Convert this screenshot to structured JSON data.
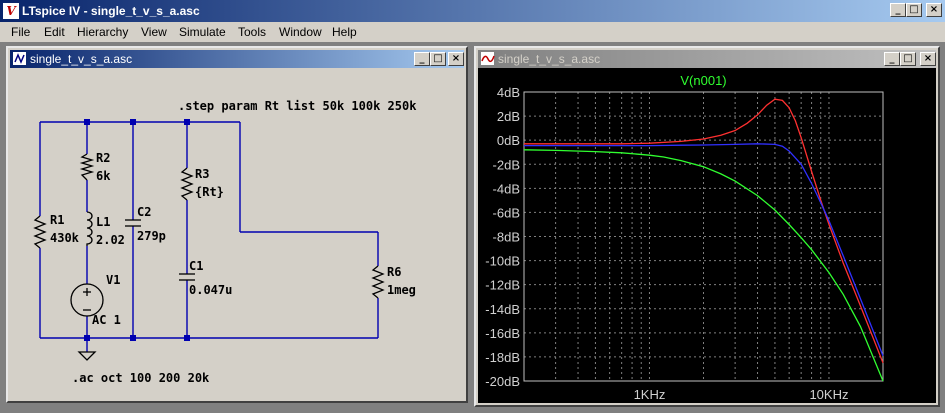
{
  "app": {
    "title": "LTspice IV - single_t_v_s_a.asc",
    "icon": "ltspice-logo-icon",
    "window_buttons": [
      "_",
      "□",
      "×"
    ]
  },
  "menu": [
    "File",
    "Edit",
    "Hierarchy",
    "View",
    "Simulate",
    "Tools",
    "Window",
    "Help"
  ],
  "schematic_window": {
    "title": "single_t_v_s_a.asc",
    "directives": {
      "step": ".step param Rt list 50k 100k 250k",
      "ac": ".ac oct 100 200 20k"
    },
    "components": {
      "R1": {
        "name": "R1",
        "value": "430k"
      },
      "R2": {
        "name": "R2",
        "value": "6k"
      },
      "L1": {
        "name": "L1",
        "value": "2.02"
      },
      "V1": {
        "name": "V1",
        "value": "AC 1"
      },
      "C2": {
        "name": "C2",
        "value": "279p"
      },
      "R3": {
        "name": "R3",
        "value": "{Rt}"
      },
      "C1": {
        "name": "C1",
        "value": "0.047u"
      },
      "R6": {
        "name": "R6",
        "value": "1meg"
      }
    },
    "colors": {
      "wire": "#0000b0",
      "background": "#d4d0c8"
    }
  },
  "plot_window": {
    "title": "single_t_v_s_a.asc",
    "chart_data": {
      "type": "line",
      "title": "V(n001)",
      "x_scale": "log",
      "xlim": [
        200,
        20000
      ],
      "ylim": [
        -20,
        4
      ],
      "yticks": [
        "4dB",
        "2dB",
        "0dB",
        "-2dB",
        "-4dB",
        "-6dB",
        "-8dB",
        "-10dB",
        "-12dB",
        "-14dB",
        "-16dB",
        "-18dB",
        "-20dB"
      ],
      "ytick_values": [
        4,
        2,
        0,
        -2,
        -4,
        -6,
        -8,
        -10,
        -12,
        -14,
        -16,
        -18,
        -20
      ],
      "xticks": [
        "1KHz",
        "10KHz"
      ],
      "xtick_values": [
        1000,
        10000
      ],
      "grid": true,
      "series": [
        {
          "color": "#ff3030",
          "x": [
            200,
            300,
            500,
            700,
            1000,
            1500,
            2000,
            2500,
            3000,
            3500,
            4000,
            4500,
            5000,
            5500,
            6000,
            6500,
            7000,
            8000,
            9000,
            10000,
            12000,
            15000,
            20000
          ],
          "values": [
            -0.3,
            -0.3,
            -0.3,
            -0.3,
            -0.25,
            -0.1,
            0.1,
            0.4,
            0.8,
            1.4,
            2.1,
            2.9,
            3.4,
            3.3,
            2.7,
            1.6,
            0.2,
            -2.6,
            -5.0,
            -7.0,
            -10.2,
            -13.8,
            -18.5
          ]
        },
        {
          "color": "#3030ff",
          "x": [
            200,
            300,
            500,
            700,
            1000,
            1500,
            2000,
            3000,
            4000,
            5000,
            5500,
            6000,
            7000,
            8000,
            9000,
            10000,
            12000,
            15000,
            20000
          ],
          "values": [
            -0.45,
            -0.45,
            -0.45,
            -0.45,
            -0.45,
            -0.42,
            -0.4,
            -0.35,
            -0.3,
            -0.35,
            -0.5,
            -0.9,
            -2.0,
            -3.6,
            -5.2,
            -6.7,
            -9.6,
            -13.2,
            -17.9
          ]
        },
        {
          "color": "#30ff30",
          "x": [
            200,
            300,
            500,
            700,
            1000,
            1200,
            1500,
            2000,
            2500,
            3000,
            4000,
            5000,
            6000,
            7000,
            8000,
            10000,
            12000,
            15000,
            20000
          ],
          "values": [
            -0.8,
            -0.85,
            -0.95,
            -1.05,
            -1.25,
            -1.4,
            -1.7,
            -2.2,
            -2.8,
            -3.4,
            -4.6,
            -5.8,
            -7.0,
            -8.1,
            -9.1,
            -11.0,
            -12.8,
            -15.5,
            -20.0
          ]
        }
      ]
    }
  }
}
